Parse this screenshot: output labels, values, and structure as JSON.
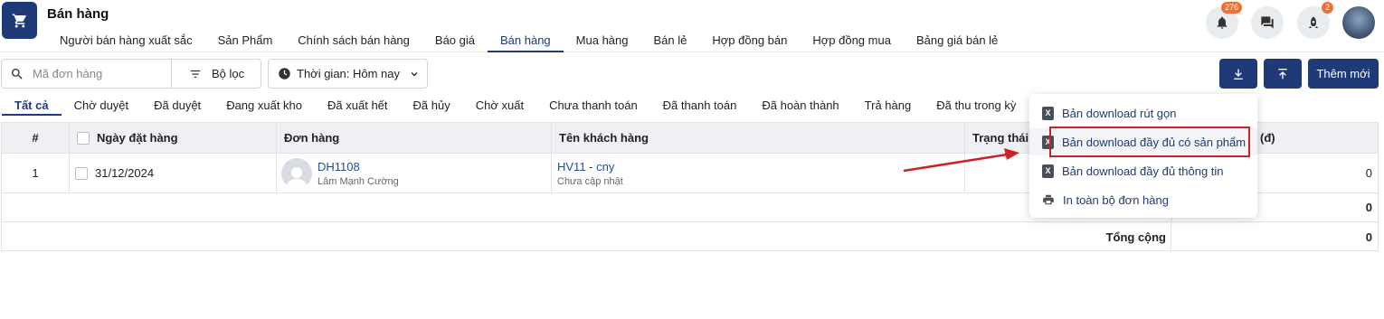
{
  "header": {
    "title": "Bán hàng",
    "nav": [
      "Người bán hàng xuất sắc",
      "Sản Phẩm",
      "Chính sách bán hàng",
      "Báo giá",
      "Bán hàng",
      "Mua hàng",
      "Bán lẻ",
      "Hợp đồng bán",
      "Hợp đồng mua",
      "Bảng giá bán lẻ"
    ],
    "active_nav": "Bán hàng",
    "notification_count": "276",
    "rocket_count": "2"
  },
  "toolbar": {
    "search_placeholder": "Mã đơn hàng",
    "filter_label": "Bộ lọc",
    "time_label": "Thời gian: Hôm nay",
    "add_label": "Thêm mới"
  },
  "tabs": [
    "Tất cả",
    "Chờ duyệt",
    "Đã duyệt",
    "Đang xuất kho",
    "Đã xuất hết",
    "Đã hủy",
    "Chờ xuất",
    "Chưa thanh toán",
    "Đã thanh toán",
    "Đã hoàn thành",
    "Trả hàng",
    "Đã thu trong kỳ"
  ],
  "active_tab": "Tất cả",
  "table": {
    "headers": {
      "index": "#",
      "order_date": "Ngày đặt hàng",
      "order": "Đơn hàng",
      "customer": "Tên khách hàng",
      "status": "Trạng thái",
      "amount": "(đ)"
    },
    "rows": [
      {
        "index": "1",
        "date": "31/12/2024",
        "order_code": "DH1108",
        "order_person": "Lâm Mạnh Cường",
        "customer": "HV11 - cny",
        "customer_sub": "Chưa cập nhật",
        "amount": "0"
      }
    ],
    "subtotal": "0",
    "total_label": "Tổng cộng",
    "total_value": "0"
  },
  "dropdown": {
    "items": [
      "Bản download rút gọn",
      "Bản download đầy đủ có sản phẩm",
      "Bản download đầy đủ thông tin",
      "In toàn bộ đơn hàng"
    ]
  },
  "colors": {
    "primary": "#1e3a78",
    "badge": "#f36e32",
    "highlight": "#d01f26"
  }
}
